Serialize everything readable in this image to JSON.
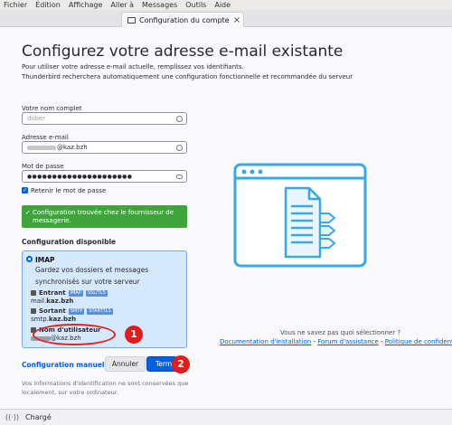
{
  "menu": [
    "Fichier",
    "Édition",
    "Affichage",
    "Aller à",
    "Messages",
    "Outils",
    "Aide"
  ],
  "tab": {
    "title": "Configuration du compte",
    "close": "×"
  },
  "page": {
    "title": "Configurez votre adresse e-mail existante",
    "subtitle1": "Pour utiliser votre adresse e-mail actuelle, remplissez vos identifiants.",
    "subtitle2": "Thunderbird recherchera automatiquement une configuration fonctionnelle et recommandée du serveur"
  },
  "form": {
    "name_label": "Votre nom complet",
    "name_value": "didier",
    "email_label": "Adresse e-mail",
    "email_value": "@kaz.bzh",
    "password_label": "Mot de passe",
    "password_value": "●●●●●●●●●●●●●●●●●●●●●",
    "remember_label": "Retenir le mot de passe"
  },
  "banner": {
    "check": "✓",
    "text1": "Configuration trouvée chez le fournisseur de",
    "text2": "messagerie."
  },
  "config": {
    "heading": "Configuration disponible",
    "imap_name": "IMAP",
    "imap_desc1": "Gardez vos dossiers et messages",
    "imap_desc2": "synchronisés sur votre serveur",
    "incoming_label": "Entrant",
    "incoming_tag1": "IMAP",
    "incoming_tag2": "SSL/TLS",
    "incoming_host_prefix": "mail.",
    "incoming_host_domain": "kaz.bzh",
    "outgoing_label": "Sortant",
    "outgoing_tag1": "SMTP",
    "outgoing_tag2": "STARTTLS",
    "outgoing_host_prefix": "smtp.",
    "outgoing_host_domain": "kaz.bzh",
    "username_label": "Nom d'utilisateur",
    "username_value": "@kaz.bzh"
  },
  "actions": {
    "manual": "Configuration manuelle",
    "cancel": "Annuler",
    "finish": "Term"
  },
  "footer": {
    "line1": "Vos informations d'identification ne sont conservées que",
    "line2": "localement, sur votre ordinateur."
  },
  "help": {
    "question": "Vous ne savez pas quoi sélectionner ?",
    "link1": "Documentation d'installation",
    "sep": " - ",
    "link2": "Forum d'assistance",
    "link3": "Politique de confidentialité"
  },
  "annotations": {
    "marker1": "1",
    "marker2": "2"
  },
  "status": {
    "text": "Chargé"
  },
  "colors": {
    "accent": "#0061e0",
    "success": "#3fa53b",
    "annotation": "#e21b1b",
    "illustration": "#38a8e8"
  },
  "icons": [
    "mail-icon",
    "close-icon",
    "clear-icon",
    "eye-icon",
    "check-icon",
    "checkmark-icon",
    "radio-icon",
    "server-icon",
    "document-illustration",
    "wifi-icon"
  ]
}
